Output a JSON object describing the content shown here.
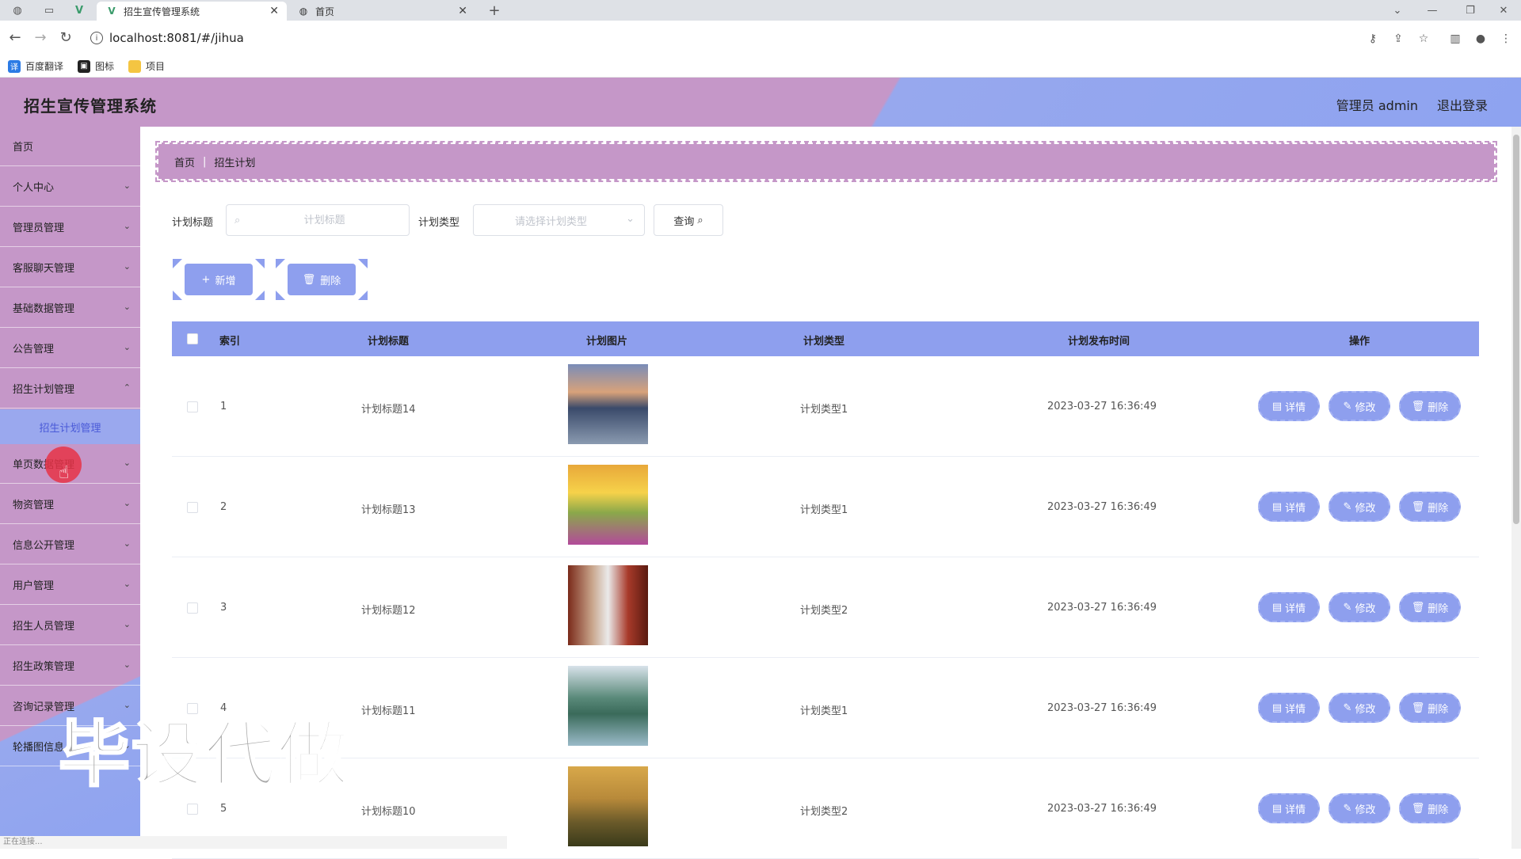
{
  "browser": {
    "tabs": [
      {
        "title": "招生宣传管理系统",
        "active": true
      },
      {
        "title": "首页",
        "active": false
      }
    ],
    "new_tab": "+",
    "url": "localhost:8081/#/jihua",
    "bookmarks": [
      "百度翻译",
      "图标",
      "项目"
    ]
  },
  "header": {
    "title": "招生宣传管理系统",
    "admin_label": "管理员 admin",
    "logout": "退出登录"
  },
  "sidebar": {
    "items": [
      {
        "label": "首页",
        "has_children": false
      },
      {
        "label": "个人中心",
        "has_children": true
      },
      {
        "label": "管理员管理",
        "has_children": true
      },
      {
        "label": "客服聊天管理",
        "has_children": true
      },
      {
        "label": "基础数据管理",
        "has_children": true
      },
      {
        "label": "公告管理",
        "has_children": true
      },
      {
        "label": "招生计划管理",
        "has_children": true
      },
      {
        "label": "单页数据管理",
        "has_children": true
      },
      {
        "label": "物资管理",
        "has_children": true
      },
      {
        "label": "信息公开管理",
        "has_children": true
      },
      {
        "label": "用户管理",
        "has_children": true
      },
      {
        "label": "招生人员管理",
        "has_children": true
      },
      {
        "label": "招生政策管理",
        "has_children": true
      },
      {
        "label": "咨询记录管理",
        "has_children": true
      },
      {
        "label": "轮播图信息",
        "has_children": true
      }
    ],
    "sub_item": "招生计划管理"
  },
  "breadcrumb": {
    "home": "首页",
    "separator": "|",
    "current": "招生计划"
  },
  "filters": {
    "title_label": "计划标题",
    "title_placeholder": "计划标题",
    "type_label": "计划类型",
    "type_placeholder": "请选择计划类型",
    "query": "查询"
  },
  "actions": {
    "add": "新增",
    "delete": "删除"
  },
  "table": {
    "columns": [
      "索引",
      "计划标题",
      "计划图片",
      "计划类型",
      "计划发布时间",
      "操作"
    ],
    "rows": [
      {
        "index": "1",
        "title": "计划标题14",
        "type": "计划类型1",
        "time": "2023-03-27 16:36:49"
      },
      {
        "index": "2",
        "title": "计划标题13",
        "type": "计划类型1",
        "time": "2023-03-27 16:36:49"
      },
      {
        "index": "3",
        "title": "计划标题12",
        "type": "计划类型2",
        "time": "2023-03-27 16:36:49"
      },
      {
        "index": "4",
        "title": "计划标题11",
        "type": "计划类型1",
        "time": "2023-03-27 16:36:49"
      },
      {
        "index": "5",
        "title": "计划标题10",
        "type": "计划类型2",
        "time": "2023-03-27 16:36:49"
      }
    ],
    "row_actions": {
      "detail": "详情",
      "edit": "修改",
      "delete": "删除"
    }
  },
  "watermark": "毕设代做",
  "status": "正在连接..."
}
